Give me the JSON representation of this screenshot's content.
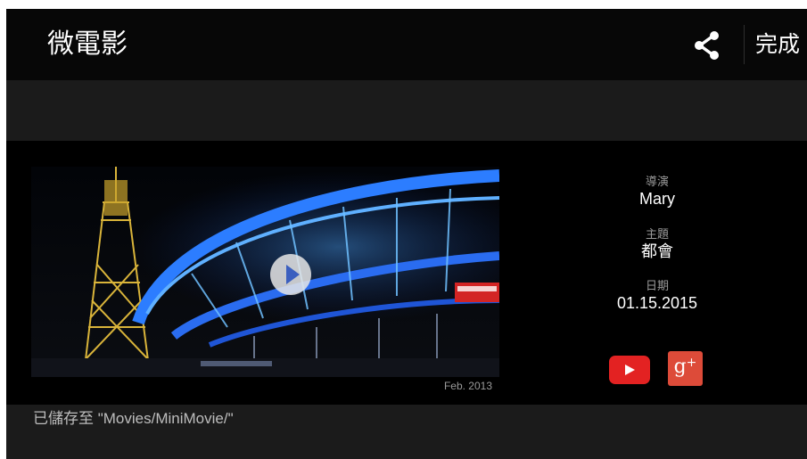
{
  "app": {
    "title": "微電影",
    "done_label": "完成",
    "share_icon": "share-icon"
  },
  "video": {
    "date_label": "Feb. 2013",
    "play_icon": "play-icon"
  },
  "details": {
    "director_label": "導演",
    "director_value": "Mary",
    "theme_label": "主題",
    "theme_value": "都會",
    "date_label": "日期",
    "date_value": "01.15.2015"
  },
  "share_targets": {
    "youtube_icon": "youtube-icon",
    "gplus_label": "g",
    "gplus_plus": "+"
  },
  "status": {
    "saved_text": "已儲存至 \"Movies/MiniMovie/\""
  },
  "colors": {
    "background": "#050505",
    "band": "#1b1b1b",
    "youtube_red": "#e32222",
    "gplus_red": "#dd4b39"
  }
}
